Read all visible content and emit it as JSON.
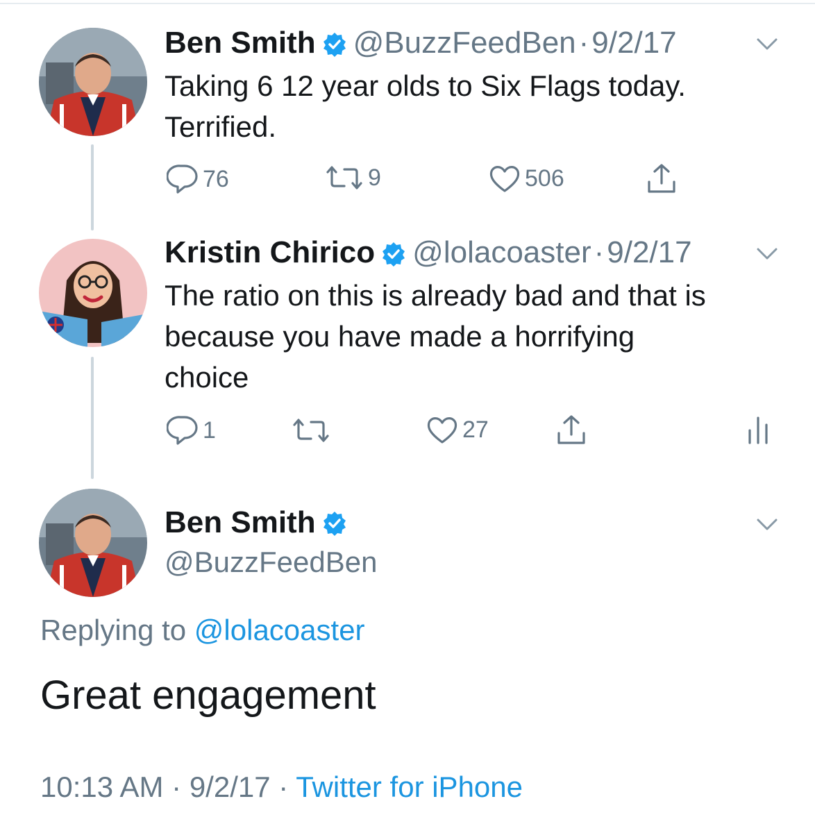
{
  "tweets": [
    {
      "name": "Ben Smith",
      "handle": "@BuzzFeedBen",
      "separator": "·",
      "date": "9/2/17",
      "text_line1": "Taking 6 12 year olds to Six Flags today.",
      "text_line2": "Terrified.",
      "replies": "76",
      "retweets": "9",
      "likes": "506"
    },
    {
      "name": "Kristin Chirico",
      "handle": "@lolacoaster",
      "separator": "·",
      "date": "9/2/17",
      "text_line1": "The ratio on this is already bad and that is",
      "text_line2": "because you have made a horrifying",
      "text_line3": "choice",
      "replies": "1",
      "retweets": "",
      "likes": "27"
    }
  ],
  "focus_tweet": {
    "name": "Ben Smith",
    "handle": "@BuzzFeedBen",
    "replying_prefix": "Replying to",
    "replying_to": "@lolacoaster",
    "text": "Great engagement",
    "time": "10:13 AM",
    "separator": "·",
    "date": "9/2/17",
    "source": "Twitter for iPhone"
  },
  "icons": {
    "verified": "verified-badge-icon",
    "chevron": "chevron-down-icon",
    "reply": "reply-icon",
    "retweet": "retweet-icon",
    "like": "heart-icon",
    "share": "share-icon",
    "analytics": "analytics-icon"
  },
  "colors": {
    "verified_blue": "#1da1f2",
    "link_blue": "#1b95e0",
    "muted_gray": "#657786",
    "thread_line": "#ccd6dd"
  }
}
